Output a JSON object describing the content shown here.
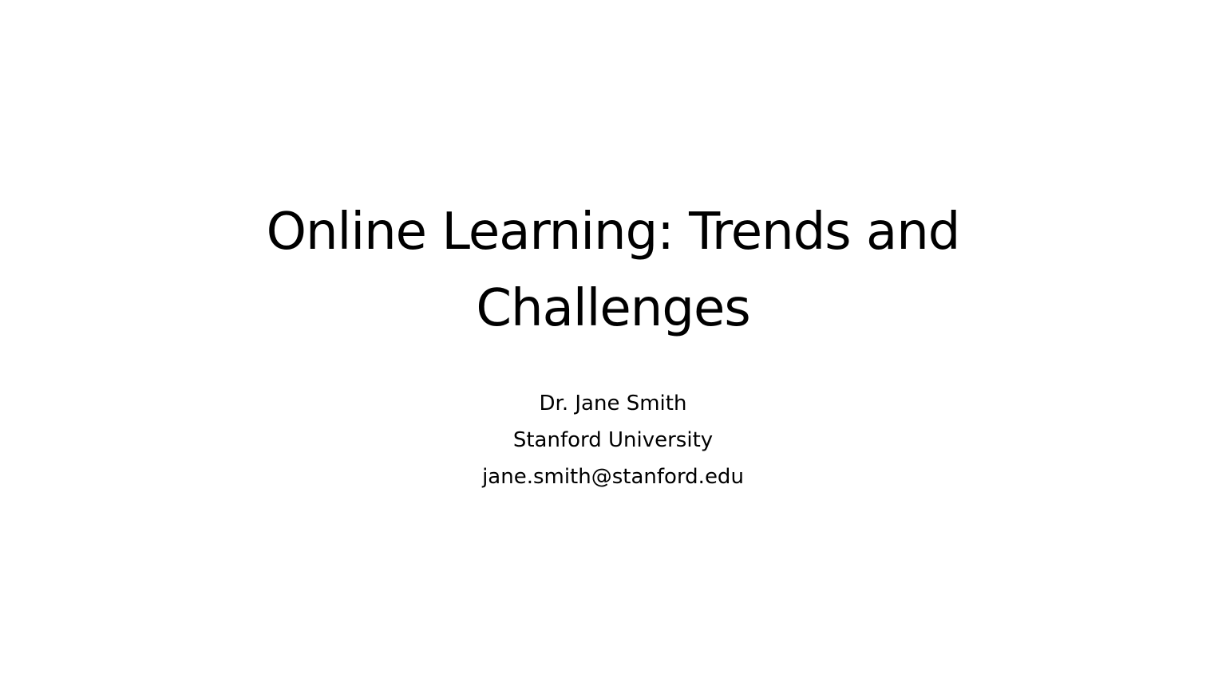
{
  "slide": {
    "title_line1": "Online Learning: Trends and",
    "title_line2": "Challenges",
    "author": "Dr. Jane Smith",
    "affiliation": "Stanford University",
    "email": "jane.smith@stanford.edu"
  }
}
